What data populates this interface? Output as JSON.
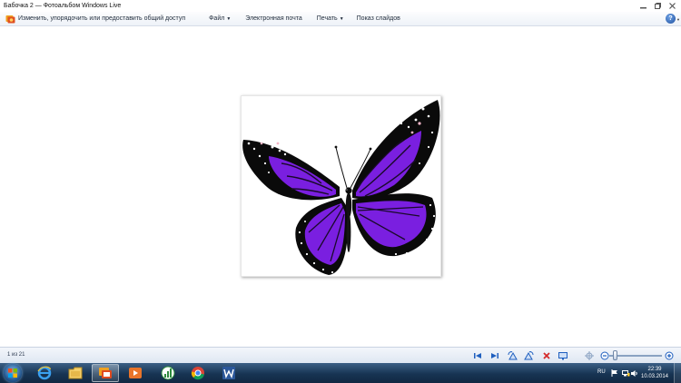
{
  "window": {
    "title": "Бабочка 2 — Фотоальбом Windows Live"
  },
  "commandbar": {
    "organize": "Изменить, упорядочить или предоставить общий доступ",
    "file": "Файл",
    "email": "Электронная почта",
    "print": "Печать",
    "slideshow": "Показ слайдов",
    "help": "?"
  },
  "status": {
    "counter": "1 из 21"
  },
  "taskbar": {
    "lang": "RU",
    "time": "22:39",
    "date": "10.03.2014"
  },
  "colors": {
    "accent": "#1f5fbf",
    "wing_purple": "#7a1fe0",
    "wing_black": "#0a0a0a",
    "delete_red": "#d42a2a"
  },
  "icons": {
    "organize": "photo-gallery-icon",
    "help": "help-icon",
    "prev": "previous-icon",
    "next": "next-icon",
    "rotate_left": "rotate-left-icon",
    "rotate_right": "rotate-right-icon",
    "delete": "delete-icon",
    "slideshow": "monitor-icon",
    "pan": "pan-icon",
    "zoom_out": "zoom-out-icon",
    "zoom_in": "zoom-in-icon"
  }
}
